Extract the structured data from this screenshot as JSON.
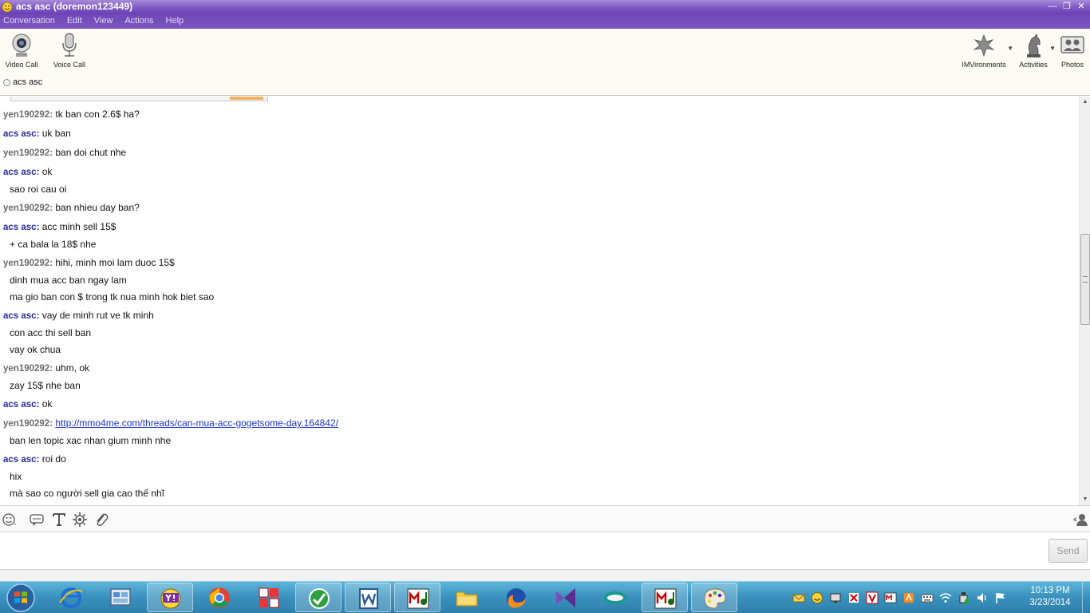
{
  "window": {
    "title": "acs asc (doremon123449)"
  },
  "menu": {
    "items": [
      "Conversation",
      "Edit",
      "View",
      "Actions",
      "Help"
    ]
  },
  "toolbar": {
    "video_call_label": "Video Call",
    "voice_call_label": "Voice Call",
    "imvironments_label": "IMVironments",
    "activities_label": "Activities",
    "photos_label": "Photos"
  },
  "contact": {
    "name": "acs asc"
  },
  "conversation": {
    "messages": [
      {
        "sender": "yen190292:",
        "text": " tk ban con 2.6$ ha?"
      },
      {
        "sender": "acs asc:",
        "text": " uk ban"
      },
      {
        "sender": "yen190292:",
        "text": " ban doi chut nhe"
      },
      {
        "sender": "acs asc:",
        "text": " ok"
      },
      {
        "sender": "",
        "text": "sao roi cau oi"
      },
      {
        "sender": "yen190292:",
        "text": " ban nhieu day ban?"
      },
      {
        "sender": "acs asc:",
        "text": " acc minh sell 15$"
      },
      {
        "sender": "",
        "text": "+ ca bala la 18$ nhe"
      },
      {
        "sender": "yen190292:",
        "text": " hihi, minh moi lam duoc 15$"
      },
      {
        "sender": "",
        "text": "dinh mua acc ban ngay lam"
      },
      {
        "sender": "",
        "text": "ma gio ban con $ trong tk nua minh hok biet sao"
      },
      {
        "sender": "acs asc:",
        "text": " vay de minh rut ve tk minh"
      },
      {
        "sender": "",
        "text": "con acc thi sell ban"
      },
      {
        "sender": "",
        "text": "vay ok chua"
      },
      {
        "sender": "yen190292:",
        "text": " uhm, ok"
      },
      {
        "sender": "",
        "text": "zay 15$ nhe ban"
      },
      {
        "sender": "acs asc:",
        "text": " ok"
      },
      {
        "sender": "yen190292:",
        "text": "",
        "link": "http://mmo4me.com/threads/can-mua-acc-gogetsome-day.164842/"
      },
      {
        "sender": "",
        "text": "ban len topic xac nhan gium minh nhe"
      },
      {
        "sender": "acs asc:",
        "text": " roi do"
      },
      {
        "sender": "",
        "text": "hix"
      },
      {
        "sender": "",
        "text": "mà sao co người sell gia cao thế nhĩ"
      }
    ]
  },
  "input": {
    "value": "",
    "send_label": "Send"
  },
  "taskbar": {
    "clock_time": "10:13 PM",
    "clock_date": "3/23/2014"
  },
  "colors": {
    "title_bar": "#7e57c2",
    "menu_bar": "#7048b8",
    "sender_self": "#2a2a9a",
    "sender_other": "#6b6b6b",
    "link": "#1a33cc",
    "taskbar": "#3b93c0"
  },
  "icons": {
    "title": "yahoo-messenger-smiley-icon",
    "video_call": "webcam-icon",
    "voice_call": "microphone-icon",
    "imvironments": "leaf-icon",
    "activities": "chess-knight-icon",
    "photos": "photos-people-icon",
    "emoticons": "smiley-icon",
    "nudge": "speech-bubble-icon",
    "font": "text-format-icon",
    "settings": "gear-icon",
    "attach": "paperclip-icon",
    "contact_panel": "person-icon"
  }
}
